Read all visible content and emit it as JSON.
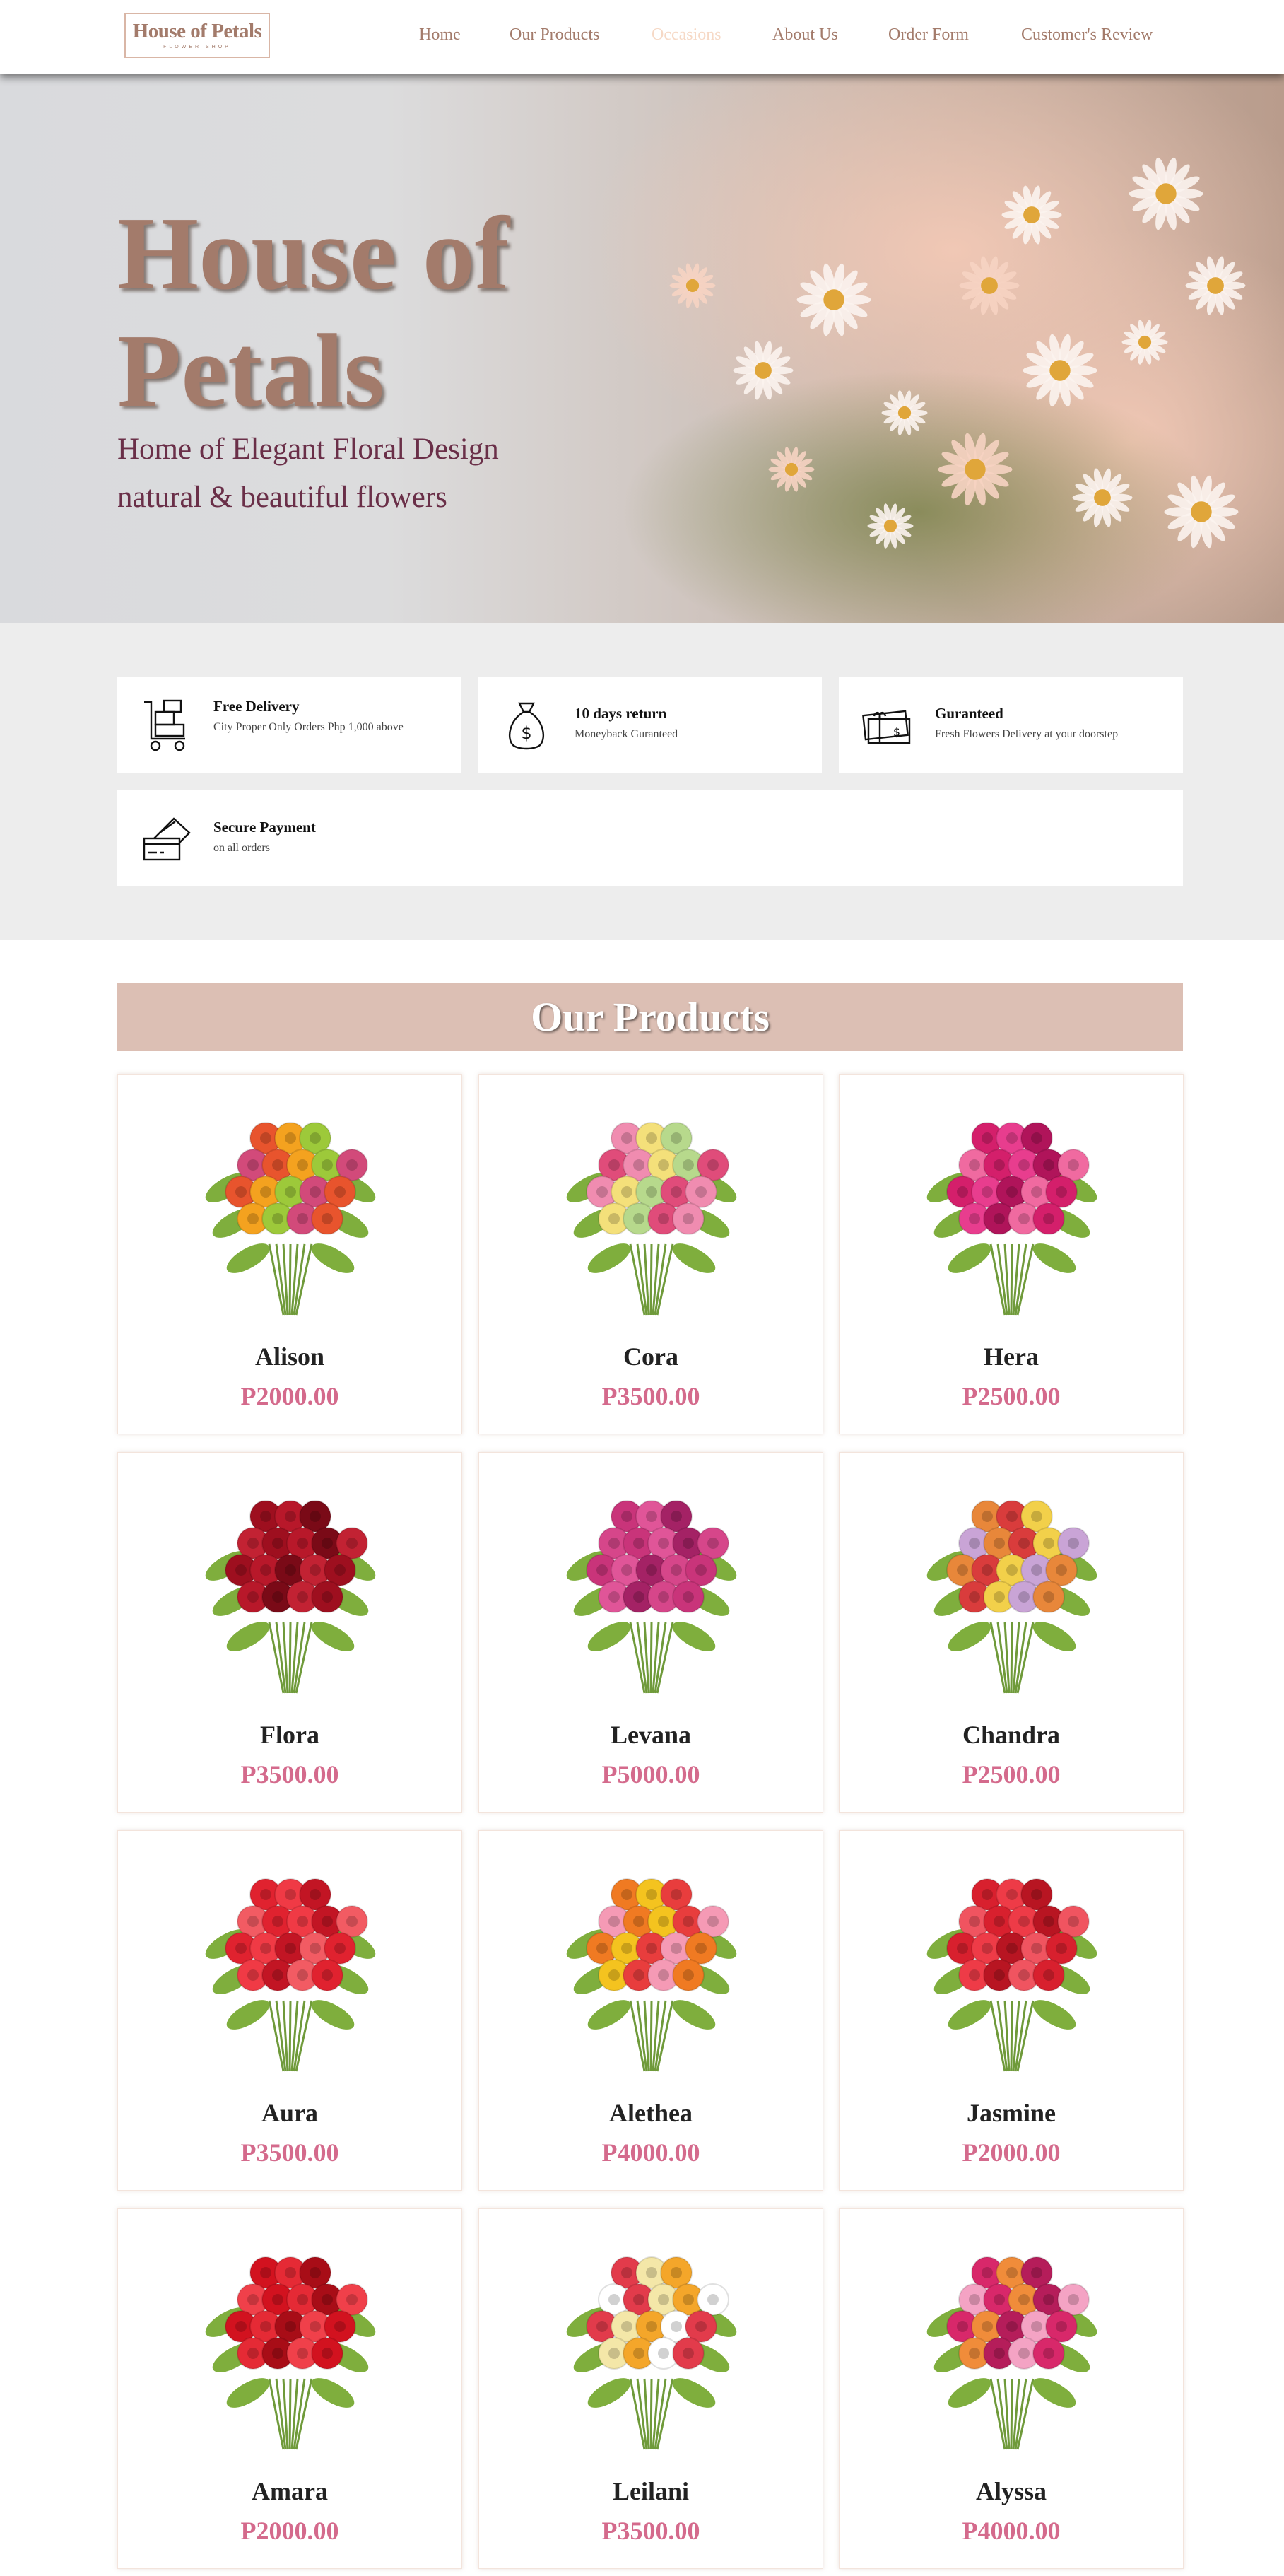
{
  "header": {
    "logo_main": "House of Petals",
    "logo_sub": "FLOWER SHOP",
    "nav": [
      {
        "label": "Home"
      },
      {
        "label": "Our Products"
      },
      {
        "label": "Occasions"
      },
      {
        "label": "About Us"
      },
      {
        "label": "Order Form"
      },
      {
        "label": "Customer's Review"
      }
    ],
    "active_nav": "Occasions"
  },
  "hero": {
    "title_line1": "House of",
    "title_line2": "Petals",
    "subtitle_line1": "Home of Elegant Floral Design",
    "subtitle_line2": "natural & beautiful flowers"
  },
  "features": [
    {
      "icon": "delivery-cart-icon",
      "title": "Free Delivery",
      "desc": "City Proper Only Orders Php 1,000 above"
    },
    {
      "icon": "money-bag-icon",
      "title": "10 days return",
      "desc": "Moneyback Guranteed"
    },
    {
      "icon": "gift-card-icon",
      "title": "Guranteed",
      "desc": "Fresh Flowers Delivery at your doorstep"
    },
    {
      "icon": "credit-card-icon",
      "title": "Secure Payment",
      "desc": "on all orders"
    }
  ],
  "products_heading": "Our Products",
  "products": [
    {
      "name": "Alison",
      "price": "P2000.00",
      "colors": [
        "#e8542d",
        "#f4a21f",
        "#9dc93a",
        "#d24a7a"
      ]
    },
    {
      "name": "Cora",
      "price": "P3500.00",
      "colors": [
        "#f08cb0",
        "#f4e07a",
        "#b7d98c",
        "#e04c7a"
      ]
    },
    {
      "name": "Hera",
      "price": "P2500.00",
      "colors": [
        "#d41f6b",
        "#e83d8e",
        "#b0145a",
        "#f06aa0"
      ]
    },
    {
      "name": "Flora",
      "price": "P3500.00",
      "colors": [
        "#9e0f1f",
        "#b8182a",
        "#7a0a17",
        "#c22233"
      ]
    },
    {
      "name": "Levana",
      "price": "P5000.00",
      "colors": [
        "#c9347a",
        "#e05598",
        "#a42265",
        "#d6468a"
      ]
    },
    {
      "name": "Chandra",
      "price": "P2500.00",
      "colors": [
        "#e8873a",
        "#d93c3c",
        "#f2d04a",
        "#c9a4d6"
      ]
    },
    {
      "name": "Aura",
      "price": "P3500.00",
      "colors": [
        "#e0222f",
        "#f03a45",
        "#c21524",
        "#f25b63"
      ]
    },
    {
      "name": "Alethea",
      "price": "P4000.00",
      "colors": [
        "#f07a22",
        "#f4c31f",
        "#e83d3d",
        "#f59ab5"
      ]
    },
    {
      "name": "Jasmine",
      "price": "P2000.00",
      "colors": [
        "#d8202e",
        "#ee3b47",
        "#b81522",
        "#f05460"
      ]
    },
    {
      "name": "Amara",
      "price": "P2000.00",
      "colors": [
        "#d2121f",
        "#e52a35",
        "#a80d17",
        "#f0404a"
      ]
    },
    {
      "name": "Leilani",
      "price": "P3500.00",
      "colors": [
        "#e23b4b",
        "#f4e7a8",
        "#f4a62a",
        "#ffffff"
      ]
    },
    {
      "name": "Alyssa",
      "price": "P4000.00",
      "colors": [
        "#d8286a",
        "#f08c3a",
        "#b51d5a",
        "#f4a3c4"
      ]
    }
  ]
}
